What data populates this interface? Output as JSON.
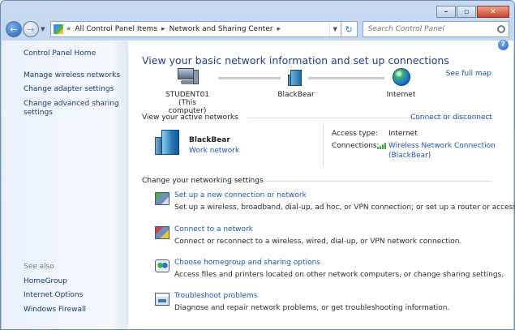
{
  "window": {
    "caption": {
      "minimize": "–",
      "maximize": "▫",
      "close": "✕"
    }
  },
  "address_bar": {
    "overflow": "«",
    "crumbs": [
      "All Control Panel Items",
      "Network and Sharing Center"
    ],
    "separator": "▸",
    "search_placeholder": "Search Control Panel"
  },
  "help": "?",
  "sidebar": {
    "home": "Control Panel Home",
    "links": [
      "Manage wireless networks",
      "Change adapter settings",
      "Change advanced sharing",
      "settings"
    ],
    "see_also_label": "See also",
    "see_also": [
      "HomeGroup",
      "Internet Options",
      "Windows Firewall"
    ]
  },
  "main": {
    "title": "View your basic network information and set up connections",
    "see_full_map": "See full map",
    "map": {
      "computer": {
        "name": "STUDENT01",
        "subtitle": "(This computer)"
      },
      "router": {
        "name": "BlackBear"
      },
      "internet": {
        "name": "Internet"
      }
    },
    "active_networks": {
      "heading": "View your active networks",
      "connect_link": "Connect or disconnect",
      "network_name": "BlackBear",
      "network_type": "Work network",
      "access_type_label": "Access type:",
      "access_type_value": "Internet",
      "connections_label": "Connections:",
      "connections_value_1": "Wireless Network Connection",
      "connections_value_2": "(BlackBear)"
    },
    "settings": {
      "heading": "Change your networking settings",
      "tasks": [
        {
          "title": "Set up a new connection or network",
          "desc": "Set up a wireless, broadband, dial-up, ad hoc, or VPN connection; or set up a router or access point.",
          "icon": "network-setup-icon"
        },
        {
          "title": "Connect to a network",
          "desc": "Connect or reconnect to a wireless, wired, dial-up, or VPN network connection.",
          "icon": "connect-network-icon"
        },
        {
          "title": "Choose homegroup and sharing options",
          "desc": "Access files and printers located on other network computers, or change sharing settings.",
          "icon": "homegroup-icon"
        },
        {
          "title": "Troubleshoot problems",
          "desc": "Diagnose and repair network problems, or get troubleshooting information.",
          "icon": "troubleshoot-icon"
        }
      ]
    }
  }
}
